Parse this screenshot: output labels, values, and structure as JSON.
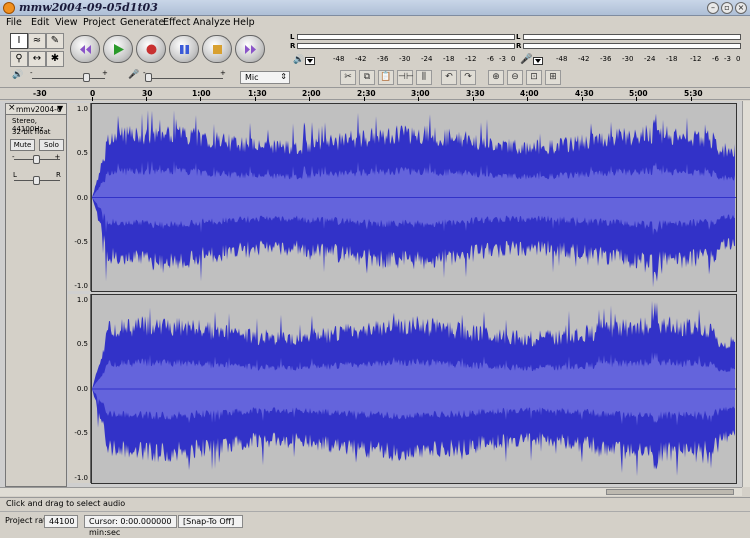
{
  "window": {
    "title": "mmw2004-09-05d1t03"
  },
  "menu": [
    "File",
    "Edit",
    "View",
    "Project",
    "Generate",
    "Effect",
    "Analyze",
    "Help"
  ],
  "meter": {
    "left_label": "L",
    "right_label": "R",
    "ticks": [
      "-48",
      "-42",
      "-36",
      "-30",
      "-24",
      "-18",
      "-12",
      "-6",
      "-3",
      "0"
    ]
  },
  "mixer": {
    "input_source": "Mic"
  },
  "ruler": [
    "-30",
    "0",
    "30",
    "1:00",
    "1:30",
    "2:00",
    "2:30",
    "3:00",
    "3:30",
    "4:00",
    "4:30",
    "5:00",
    "5:30"
  ],
  "track": {
    "name": "mmv2004-0",
    "info_rate": "Stereo, 44100Hz",
    "info_format": "32-bit float",
    "mute_label": "Mute",
    "solo_label": "Solo",
    "pan_left": "L",
    "pan_right": "R",
    "scale": [
      "1.0",
      "0.5",
      "0.0",
      "-0.5",
      "-1.0"
    ]
  },
  "status": {
    "message": "Click and drag to select audio"
  },
  "bottom": {
    "rate_label": "Project rate:",
    "rate_value": "44100",
    "cursor_text": "Cursor: 0:00.000000 min:sec",
    "snap_text": "[Snap-To Off]"
  },
  "colors": {
    "waveform": "#3232c8",
    "waveform_rms": "#6464dc",
    "wave_bg": "#c0c0c0"
  }
}
